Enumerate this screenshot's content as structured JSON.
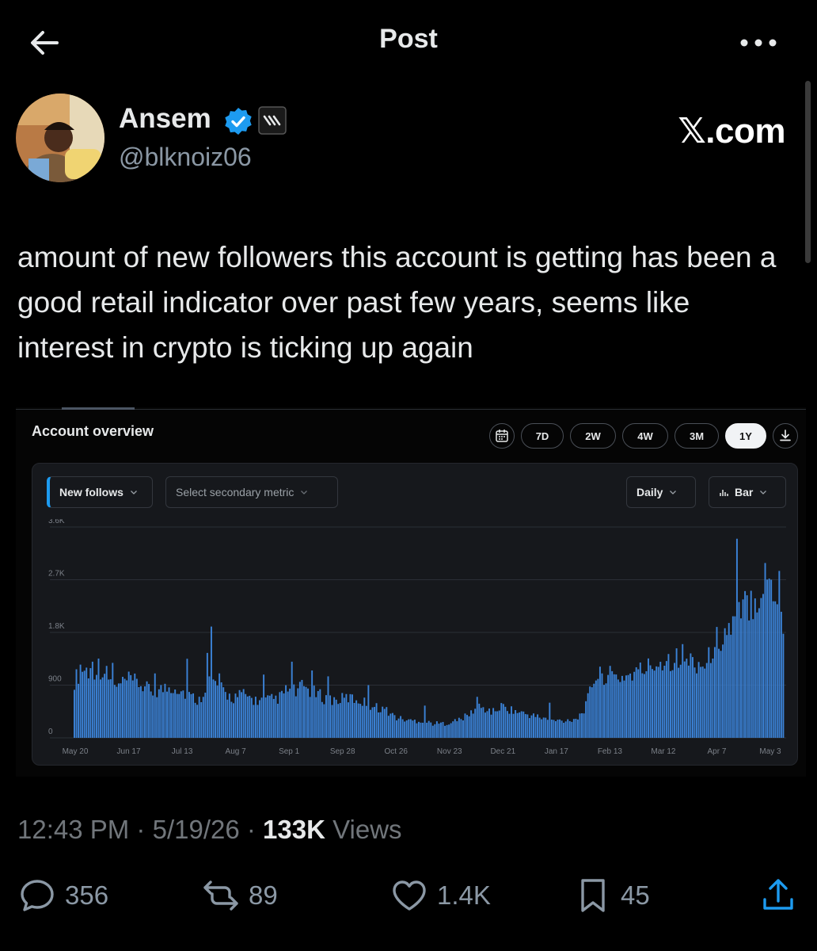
{
  "header": {
    "title": "Post"
  },
  "author": {
    "name": "Ansem",
    "handle": "@blknoiz06",
    "watermark": "𝕏.com"
  },
  "tweet": {
    "text": "amount of new followers this account is getting has been a good retail indicator over past few years, seems like interest in crypto is ticking up again"
  },
  "card": {
    "title": "Account overview",
    "ranges": [
      "7D",
      "2W",
      "4W",
      "3M",
      "1Y"
    ],
    "active_range": "1Y",
    "primary_metric": "New follows",
    "secondary_metric_placeholder": "Select secondary metric",
    "granularity": "Daily",
    "chart_style": "Bar"
  },
  "chart_data": {
    "type": "bar",
    "series": [
      {
        "name": "New follows",
        "color": "#3b82d6"
      }
    ],
    "xlabel": "",
    "ylabel": "",
    "ylim": [
      0,
      3600
    ],
    "yticks": [
      "0",
      "900",
      "1.8K",
      "2.7K",
      "3.6K"
    ],
    "x_tick_labels": [
      "May 20",
      "Jun 17",
      "Jul 13",
      "Aug 7",
      "Sep 1",
      "Sep 28",
      "Oct 26",
      "Nov 23",
      "Dec 21",
      "Jan 17",
      "Feb 13",
      "Mar 12",
      "Apr 7",
      "May 3"
    ],
    "anchors_days_values": [
      [
        0,
        1000
      ],
      [
        4,
        1200
      ],
      [
        8,
        1150
      ],
      [
        12,
        1250
      ],
      [
        16,
        1100
      ],
      [
        20,
        850
      ],
      [
        26,
        1000
      ],
      [
        32,
        950
      ],
      [
        38,
        800
      ],
      [
        44,
        850
      ],
      [
        50,
        900
      ],
      [
        56,
        750
      ],
      [
        62,
        650
      ],
      [
        66,
        1000
      ],
      [
        70,
        950
      ],
      [
        74,
        800
      ],
      [
        78,
        700
      ],
      [
        84,
        750
      ],
      [
        90,
        650
      ],
      [
        96,
        650
      ],
      [
        102,
        700
      ],
      [
        106,
        850
      ],
      [
        110,
        800
      ],
      [
        114,
        900
      ],
      [
        118,
        800
      ],
      [
        124,
        700
      ],
      [
        130,
        650
      ],
      [
        136,
        700
      ],
      [
        142,
        650
      ],
      [
        148,
        550
      ],
      [
        154,
        500
      ],
      [
        160,
        350
      ],
      [
        166,
        300
      ],
      [
        172,
        300
      ],
      [
        178,
        250
      ],
      [
        184,
        250
      ],
      [
        190,
        300
      ],
      [
        196,
        400
      ],
      [
        200,
        550
      ],
      [
        204,
        500
      ],
      [
        208,
        450
      ],
      [
        212,
        550
      ],
      [
        216,
        500
      ],
      [
        220,
        450
      ],
      [
        226,
        400
      ],
      [
        232,
        350
      ],
      [
        238,
        300
      ],
      [
        244,
        300
      ],
      [
        250,
        350
      ],
      [
        254,
        550
      ],
      [
        258,
        1050
      ],
      [
        264,
        1100
      ],
      [
        270,
        1050
      ],
      [
        276,
        1100
      ],
      [
        280,
        1150
      ],
      [
        286,
        1250
      ],
      [
        292,
        1350
      ],
      [
        298,
        1400
      ],
      [
        302,
        1350
      ],
      [
        306,
        1350
      ],
      [
        310,
        1300
      ],
      [
        314,
        1250
      ],
      [
        316,
        1500
      ],
      [
        319,
        1700
      ],
      [
        324,
        1850
      ],
      [
        330,
        2100
      ],
      [
        335,
        2400
      ],
      [
        339,
        2500
      ],
      [
        344,
        2800
      ],
      [
        348,
        2600
      ],
      [
        352,
        2000
      ]
    ],
    "spikes_days_values": [
      [
        3,
        1250
      ],
      [
        9,
        1300
      ],
      [
        19,
        1280
      ],
      [
        40,
        1100
      ],
      [
        56,
        1350
      ],
      [
        66,
        1450
      ],
      [
        68,
        1900
      ],
      [
        72,
        1100
      ],
      [
        94,
        1080
      ],
      [
        108,
        1300
      ],
      [
        118,
        1150
      ],
      [
        126,
        1050
      ],
      [
        146,
        900
      ],
      [
        174,
        550
      ],
      [
        200,
        700
      ],
      [
        236,
        600
      ],
      [
        262,
        1100
      ],
      [
        302,
        1600
      ],
      [
        318,
        1550
      ],
      [
        329,
        3400
      ],
      [
        346,
        2700
      ],
      [
        350,
        2850
      ]
    ],
    "days_total": 352
  },
  "meta": {
    "time": "12:43 PM",
    "sep": "·",
    "date": "5/19/26",
    "views_count": "133K",
    "views_label": "Views"
  },
  "actions": {
    "replies": "356",
    "reposts": "89",
    "likes": "1.4K",
    "bookmarks": "45"
  },
  "colors": {
    "accent": "#1d9bf0",
    "bar": "#3b82d6"
  }
}
